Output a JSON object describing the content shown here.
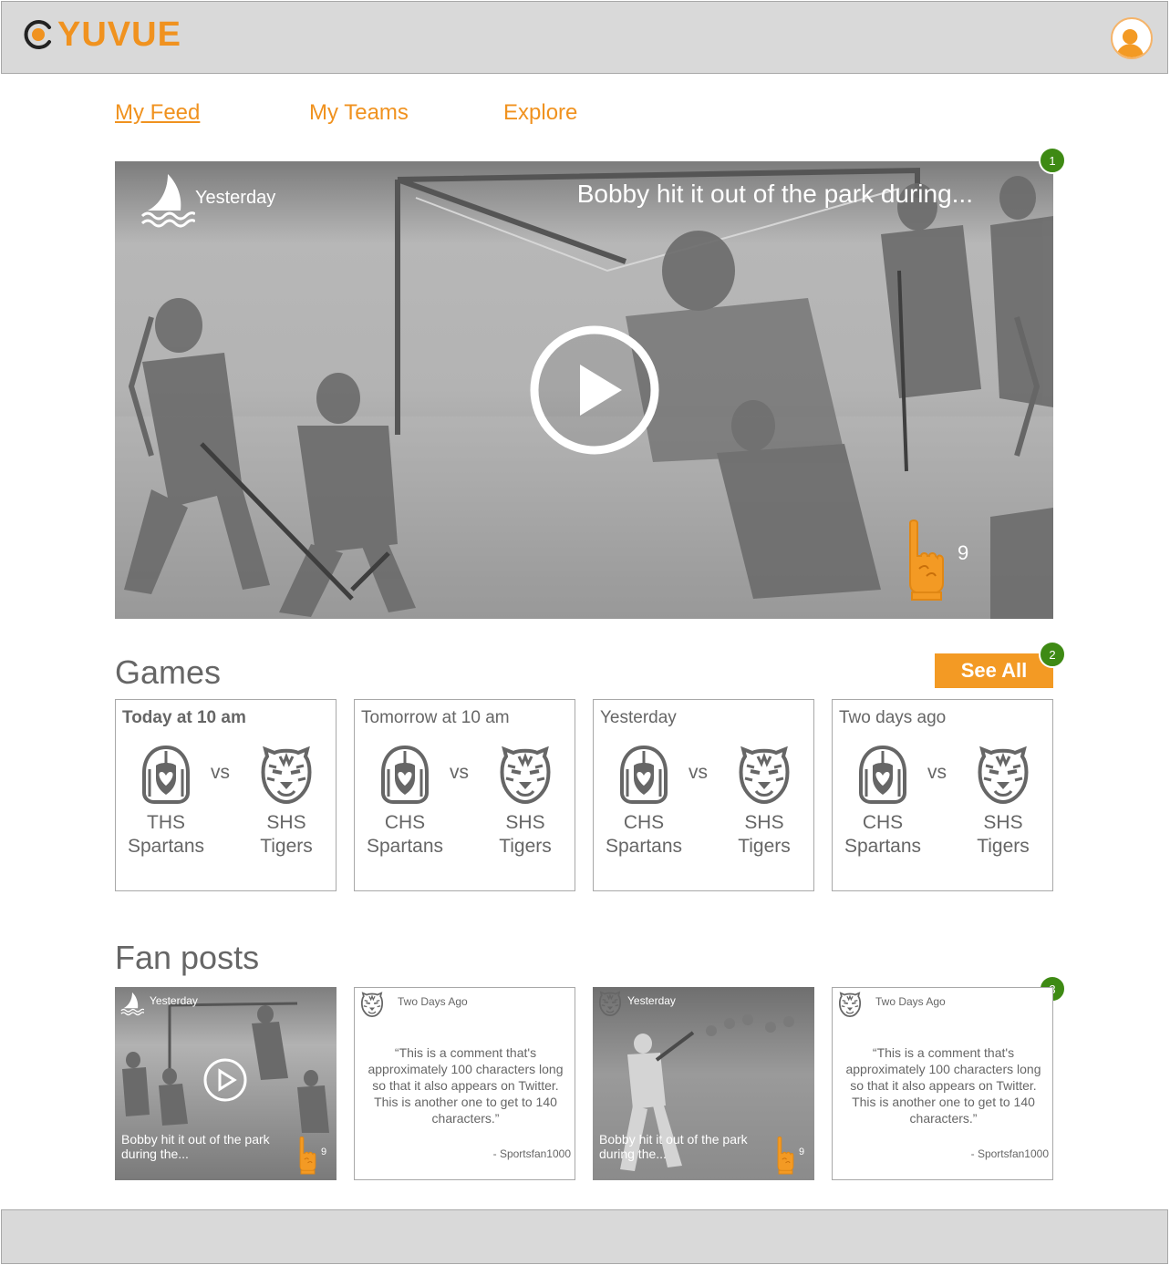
{
  "brand": {
    "name": "YUVUE",
    "accent": "#f0921f"
  },
  "nav": {
    "items": [
      {
        "label": "My Feed",
        "active": true
      },
      {
        "label": "My Teams",
        "active": false
      },
      {
        "label": "Explore",
        "active": false
      }
    ]
  },
  "hero": {
    "date": "Yesterday",
    "title": "Bobby hit it out of the park during...",
    "likes": "9",
    "team_icon": "shark-icon"
  },
  "badges": [
    "1",
    "2",
    "3"
  ],
  "games": {
    "title": "Games",
    "see_all_label": "See All",
    "cards": [
      {
        "when": "Today at 10 am",
        "home": [
          "THS",
          "Spartans"
        ],
        "vs": "vs",
        "away": [
          "SHS",
          "Tigers"
        ]
      },
      {
        "when": "Tomorrow at 10 am",
        "home": [
          "CHS",
          "Spartans"
        ],
        "vs": "vs",
        "away": [
          "SHS",
          "Tigers"
        ]
      },
      {
        "when": "Yesterday",
        "home": [
          "CHS",
          "Spartans"
        ],
        "vs": "vs",
        "away": [
          "SHS",
          "Tigers"
        ]
      },
      {
        "when": "Two days ago",
        "home": [
          "CHS",
          "Spartans"
        ],
        "vs": "vs",
        "away": [
          "SHS",
          "Tigers"
        ]
      }
    ]
  },
  "fan_posts": {
    "title": "Fan posts",
    "posts": [
      {
        "type": "video",
        "date": "Yesterday",
        "caption": "Bobby hit it out of the park during the...",
        "likes": "9",
        "icon": "shark-icon"
      },
      {
        "type": "text",
        "date": "Two Days Ago",
        "quote": "“This is a comment that's approximately 100 characters long so that it also appears on Twitter. This is another one to get to 140 characters.”",
        "author": "- Sportsfan1000",
        "icon": "tiger-icon"
      },
      {
        "type": "image",
        "date": "Yesterday",
        "caption": "Bobby hit it out of the park during the...",
        "likes": "9",
        "icon": "tiger-icon"
      },
      {
        "type": "text",
        "date": "Two Days Ago",
        "quote": "“This is a comment that's approximately 100 characters long so that it also appears on Twitter. This is another one to get to 140 characters.”",
        "author": "- Sportsfan1000",
        "icon": "tiger-icon"
      }
    ]
  }
}
